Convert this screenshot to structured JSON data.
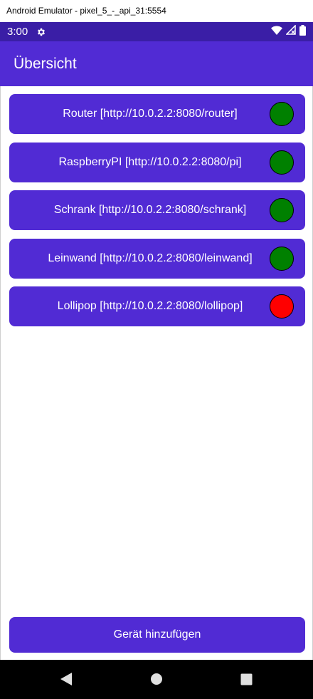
{
  "window": {
    "title": "Android Emulator - pixel_5_-_api_31:5554"
  },
  "status_bar": {
    "time": "3:00",
    "icons": [
      "gear-icon",
      "wifi-icon",
      "signal-icon",
      "battery-icon"
    ]
  },
  "app_bar": {
    "title": "Übersicht"
  },
  "devices": [
    {
      "label": "Router [http://10.0.2.2:8080/router]",
      "status": "online",
      "color": "#008000"
    },
    {
      "label": "RaspberryPI [http://10.0.2.2:8080/pi]",
      "status": "online",
      "color": "#008000"
    },
    {
      "label": "Schrank [http://10.0.2.2:8080/schrank]",
      "status": "online",
      "color": "#008000"
    },
    {
      "label": "Leinwand [http://10.0.2.2:8080/leinwand]",
      "status": "online",
      "color": "#008000"
    },
    {
      "label": "Lollipop [http://10.0.2.2:8080/lollipop]",
      "status": "offline",
      "color": "#ff0000"
    }
  ],
  "add_button": {
    "label": "Gerät hinzufügen"
  },
  "colors": {
    "primary": "#512bd4",
    "status_bar": "#3a1ea6",
    "online": "#008000",
    "offline": "#ff0000"
  },
  "nav_bar": {
    "icons": [
      "back-icon",
      "home-icon",
      "recents-icon"
    ]
  }
}
